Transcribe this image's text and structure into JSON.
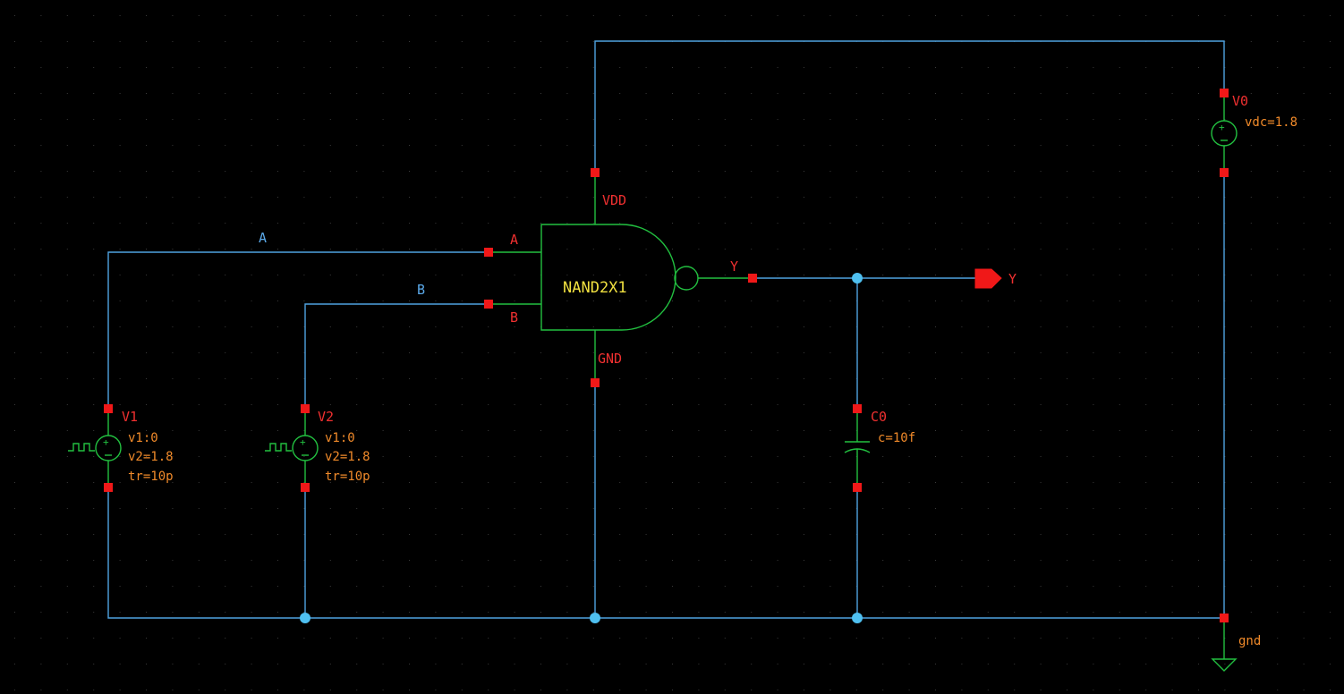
{
  "gate": {
    "name": "NAND2X1",
    "pin_a": "A",
    "pin_b": "B",
    "pin_y": "Y",
    "pin_vdd": "VDD",
    "pin_gnd": "GND"
  },
  "nets": {
    "a": "A",
    "b": "B"
  },
  "output_pin": {
    "label": "Y"
  },
  "sources": {
    "v0": {
      "name": "V0",
      "param": "vdc=1.8"
    },
    "v1": {
      "name": "V1",
      "p1": "v1:0",
      "p2": "v2=1.8",
      "p3": "tr=10p"
    },
    "v2": {
      "name": "V2",
      "p1": "v1:0",
      "p2": "v2=1.8",
      "p3": "tr=10p"
    }
  },
  "capacitor": {
    "name": "C0",
    "param": "c=10f"
  },
  "ground": {
    "label": "gnd"
  },
  "colors": {
    "wire": "#4fa3e0",
    "symbol": "#22c040",
    "pin": "#f01818",
    "background": "#000000"
  }
}
